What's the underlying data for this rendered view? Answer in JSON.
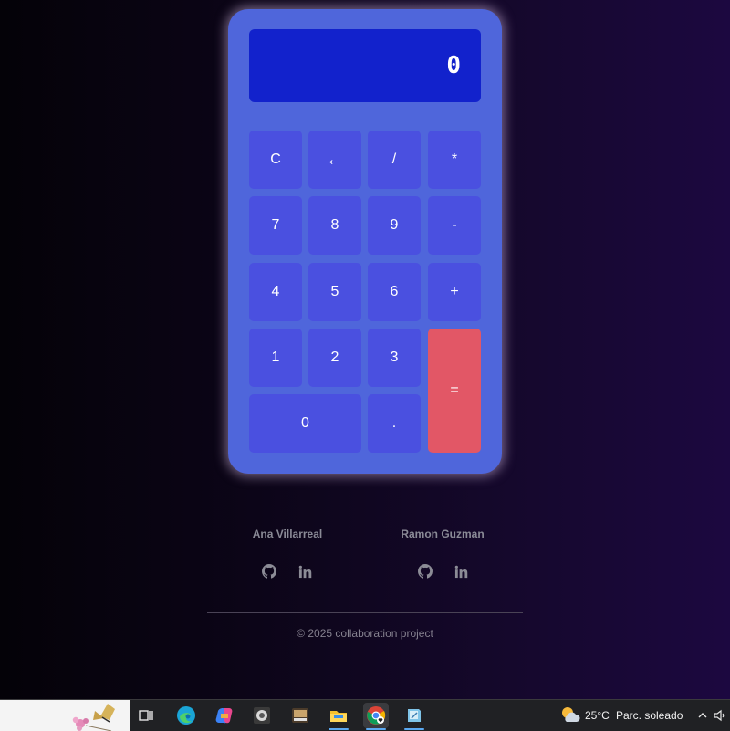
{
  "calculator": {
    "display": "0",
    "keys": {
      "clear": "C",
      "backspace": "←",
      "divide": "/",
      "multiply": "*",
      "seven": "7",
      "eight": "8",
      "nine": "9",
      "subtract": "-",
      "four": "4",
      "five": "5",
      "six": "6",
      "add": "+",
      "one": "1",
      "two": "2",
      "three": "3",
      "equals": "=",
      "zero": "0",
      "decimal": "."
    },
    "colors": {
      "body": "#4f66db",
      "display": "#1222cc",
      "key": "#4a50e0",
      "equals": "#e25766"
    }
  },
  "footer": {
    "authors": [
      {
        "name": "Ana Villarreal",
        "icons": [
          "github-icon",
          "linkedin-icon"
        ]
      },
      {
        "name": "Ramon Guzman",
        "icons": [
          "github-icon",
          "linkedin-icon"
        ]
      }
    ],
    "copyright": "© 2025 collaboration project"
  },
  "taskbar": {
    "apps": [
      "task-view-icon",
      "edge-icon",
      "copilot-icon",
      "app-icon",
      "app-icon",
      "file-explorer-icon",
      "chrome-icon",
      "app-icon"
    ],
    "weather": {
      "temperature": "25°C",
      "condition": "Parc. soleado",
      "icon": "partly-sunny-icon"
    },
    "tray": [
      "chevron-up-icon",
      "speaker-icon"
    ]
  }
}
